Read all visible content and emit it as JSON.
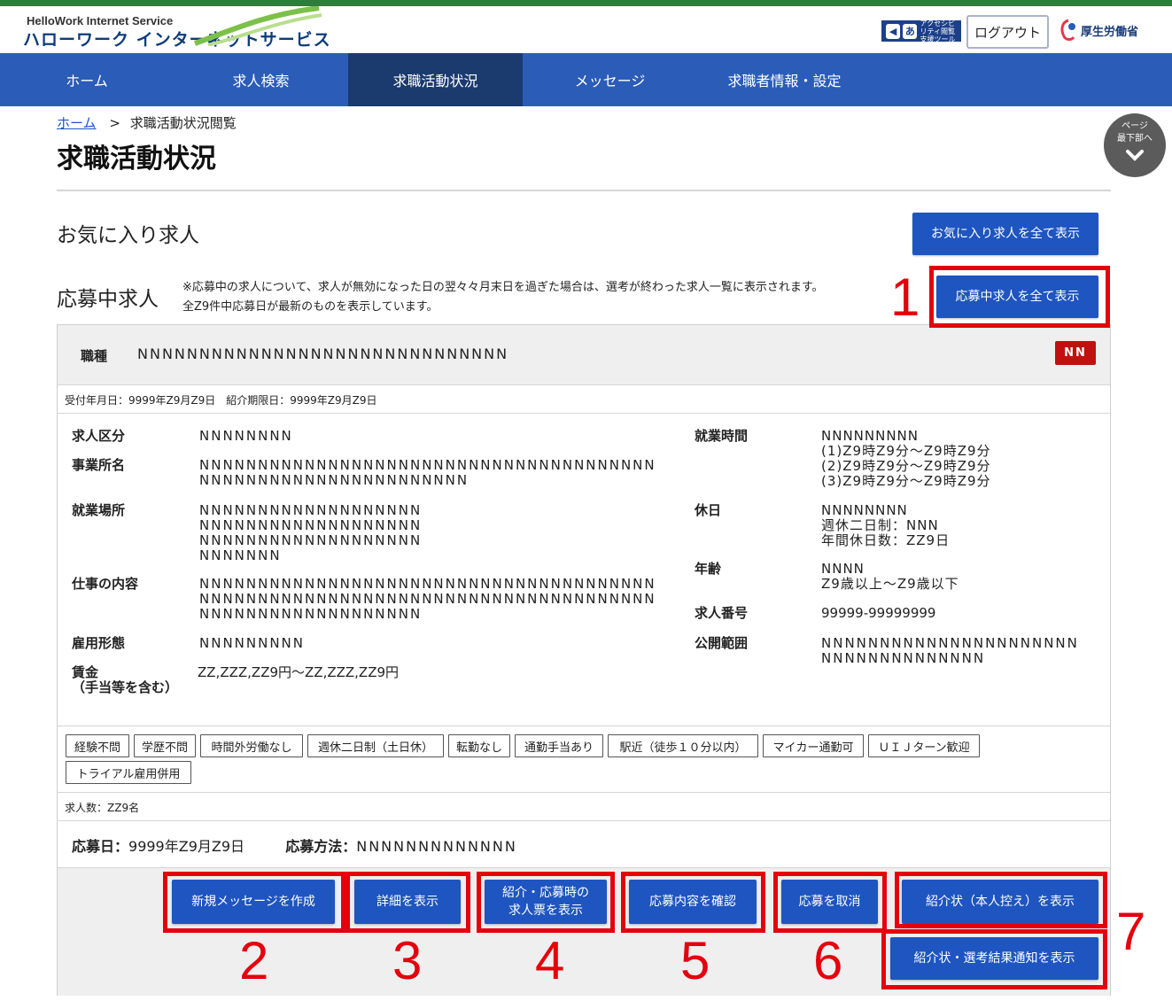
{
  "header": {
    "logo_en": "HelloWork Internet Service",
    "logo_ja": "ハローワーク インターネットサービス",
    "accessibility_tool": "アクセシビリティ閲覧支援ツール",
    "logout_label": "ログアウト",
    "mhlw_label": "厚生労働省"
  },
  "nav": {
    "items": [
      {
        "label": "ホーム"
      },
      {
        "label": "求人検索"
      },
      {
        "label": "求職活動状況"
      },
      {
        "label": "メッセージ"
      },
      {
        "label": "求職者情報・設定"
      }
    ],
    "active_index": 2
  },
  "breadcrumb": {
    "home": "ホーム",
    "separator": ">",
    "current": "求職活動状況閲覧"
  },
  "page_title": "求職活動状況",
  "scroll_button": {
    "line1": "ページ",
    "line2": "最下部へ"
  },
  "favorites": {
    "heading": "お気に入り求人",
    "show_all_label": "お気に入り求人を全て表示"
  },
  "applying": {
    "heading": "応募中求人",
    "note_line1": "※応募中の求人について、求人が無効になった日の翌々々月末日を過ぎた場合は、選考が終わった求人一覧に表示されます。",
    "note_line2": "全Z9件中応募日が最新のものを表示しています。",
    "show_all_label": "応募中求人を全て表示"
  },
  "job": {
    "occupation_label": "職種",
    "occupation_value": "NNNNNNNNNNNNNNNNNNNNNNNNNNNNNN",
    "badge": "NN",
    "dates": "受付年月日：9999年Z9月Z9日　紹介期限日：9999年Z9月Z9日",
    "left_fields": [
      {
        "label": "求人区分",
        "value": "NNNNNNNN"
      },
      {
        "label": "事業所名",
        "value": "NNNNNNNNNNNNNNNNNNNNNNNNNNNNNNNNNNNNNNNNNNNNNNNNNNNNNNNNNNNNNN"
      },
      {
        "label": "就業場所",
        "value": "NNNNNNNNNNNNNNNNNNNNNNNNNNNNNNNNNNNNNNNNNNNNNNNNNNNNNNNNNNNNNNNN"
      },
      {
        "label": "仕事の内容",
        "value": "NNNNNNNNNNNNNNNNNNNNNNNNNNNNNNNNNNNNNNNNNNNNNNNNNNNNNNNNNNNNNNNNNNNNNNNNNNNNNNNNNNNNNNNNNNNNNNNNN"
      },
      {
        "label": "雇用形態",
        "value": "NNNNNNNNN"
      },
      {
        "label": "賃金\n（手当等を含む）",
        "value": "ZZ,ZZZ,ZZ9円～ZZ,ZZZ,ZZ9円"
      }
    ],
    "right_fields": [
      {
        "label": "就業時間",
        "value": "NNNNNNNNN\n(1)Z9時Z9分～Z9時Z9分\n(2)Z9時Z9分～Z9時Z9分\n(3)Z9時Z9分～Z9時Z9分"
      },
      {
        "label": "休日",
        "value": "NNNNNNNN\n週休二日制：NNN\n年間休日数：ZZ9日"
      },
      {
        "label": "年齢",
        "value": "NNNN\nZ9歳以上～Z9歳以下"
      },
      {
        "label": "求人番号",
        "value": "99999-99999999"
      },
      {
        "label": "公開範囲",
        "value": "NNNNNNNNNNNNNNNNNNNNNNNNNNNNNNNNNNNN"
      }
    ],
    "tags": [
      "経験不問",
      "学歴不問",
      "時間外労働なし",
      "週休二日制（土日休）",
      "転勤なし",
      "通勤手当あり",
      "駅近（徒歩１０分以内）",
      "マイカー通勤可",
      "ＵＩＪターン歓迎",
      "トライアル雇用併用"
    ],
    "count": "求人数：ZZ9名",
    "apply_date_label": "応募日：",
    "apply_date_value": "9999年Z9月Z9日",
    "apply_method_label": "応募方法：",
    "apply_method_value": "NNNNNNNNNNNNN"
  },
  "actions": {
    "new_message": "新規メッセージを作成",
    "show_detail": "詳細を表示",
    "show_ticket_line1": "紹介・応募時の",
    "show_ticket_line2": "求人票を表示",
    "confirm_application": "応募内容を確認",
    "cancel_application": "応募を取消",
    "referral_copy": "紹介状（本人控え）を表示",
    "referral_result": "紹介状・選考結果通知を表示"
  },
  "callouts": [
    "1",
    "2",
    "3",
    "4",
    "5",
    "6",
    "7"
  ],
  "colors": {
    "nav": "#2b5cb8",
    "nav_active": "#1b3a6e",
    "button": "#1e55c0",
    "highlight": "#e4000d",
    "badge": "#c0100f"
  }
}
